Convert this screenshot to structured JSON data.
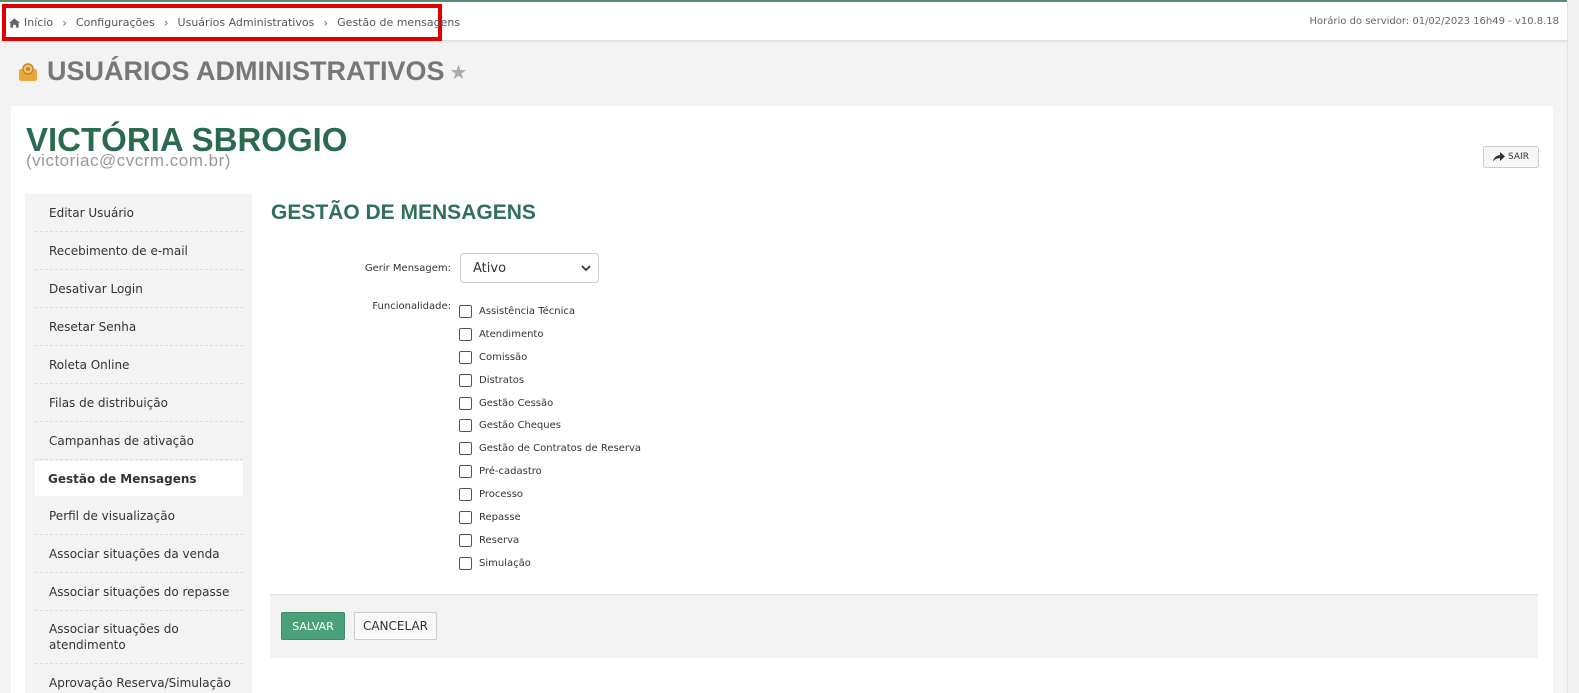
{
  "breadcrumb": {
    "items": [
      "Início",
      "Configurações",
      "Usuários Administrativos",
      "Gestão de mensagens"
    ]
  },
  "server_time": "Horário do servidor: 01/02/2023 16h49 - v10.8.18",
  "header": {
    "title": "USUÁRIOS ADMINISTRATIVOS"
  },
  "user": {
    "name": "VICTÓRIA SBROGIO",
    "email": "(victoriac@cvcrm.com.br)"
  },
  "actions": {
    "sair_label": "SAIR"
  },
  "sidebar": {
    "items": [
      "Editar Usuário",
      "Recebimento de e-mail",
      "Desativar Login",
      "Resetar Senha",
      "Roleta Online",
      "Filas de distribuição",
      "Campanhas de ativação",
      "Gestão de Mensagens",
      "Perfil de visualização",
      "Associar situações da venda",
      "Associar situações do repasse",
      "Associar situações do atendimento",
      "Aprovação Reserva/Simulação"
    ],
    "active": "Gestão de Mensagens"
  },
  "form": {
    "section_title": "GESTÃO DE MENSAGENS",
    "gerir_label": "Gerir Mensagem:",
    "gerir_value": "Ativo",
    "funcionalidade_label": "Funcionalidade:",
    "options": [
      "Assistência Técnica",
      "Atendimento",
      "Comissão",
      "Distratos",
      "Gestão Cessão",
      "Gestão Cheques",
      "Gestão de Contratos de Reserva",
      "Pré-cadastro",
      "Processo",
      "Repasse",
      "Reserva",
      "Simulação"
    ],
    "save_label": "SALVAR",
    "cancel_label": "CANCELAR"
  },
  "colors": {
    "brand_green": "#2b6b4d",
    "save_button": "#4aa07a",
    "highlight_border": "#e00000"
  }
}
